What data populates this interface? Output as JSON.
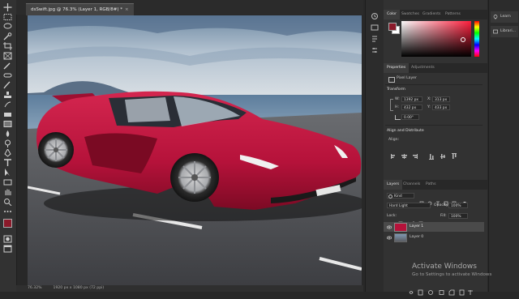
{
  "document": {
    "tab_title": "dsSwift.jpg @ 76.3% (Layer 1, RGB/8#) *",
    "close_glyph": "×"
  },
  "status": {
    "zoom": "76.32%",
    "doc_info": "1920 px x 1080 px (72 ppi)"
  },
  "color_panel": {
    "tabs": [
      "Color",
      "Swatches",
      "Gradients",
      "Patterns"
    ],
    "foreground": "#8b1a2a",
    "background": "#ffffff",
    "field_hue": "#ff1e3c"
  },
  "properties_panel": {
    "tabs": [
      "Properties",
      "Adjustments"
    ],
    "kind": "Pixel Layer",
    "transform_title": "Transform",
    "w_label": "W:",
    "w_value": "1392 px",
    "x_label": "X:",
    "x_value": "313 px",
    "h_label": "H:",
    "h_value": "432 px",
    "y_label": "Y:",
    "y_value": "433 px",
    "angle_value": "0.00°",
    "align_title": "Align and Distribute",
    "align_label": "Align:"
  },
  "layers_panel": {
    "tabs": [
      "Layers",
      "Channels",
      "Paths"
    ],
    "filter_label": "Kind",
    "blend_mode": "Hard Light",
    "opacity_label": "Opacity:",
    "opacity_value": "100%",
    "lock_label": "Lock:",
    "fill_label": "Fill:",
    "fill_value": "100%",
    "layers": [
      {
        "name": "Layer 1",
        "selected": true
      },
      {
        "name": "Layer 0",
        "selected": false
      }
    ]
  },
  "mini_panels": [
    {
      "label": "Learn",
      "icon": "lightbulb-icon"
    },
    {
      "label": "Librari...",
      "icon": "libraries-icon"
    }
  ],
  "watermark": {
    "line1": "Activate Windows",
    "line2": "Go to Settings to activate Windows"
  },
  "colors": {
    "car_body": "#b5123a",
    "ui_dark": "#323232",
    "accent": "#4a4a4a"
  }
}
